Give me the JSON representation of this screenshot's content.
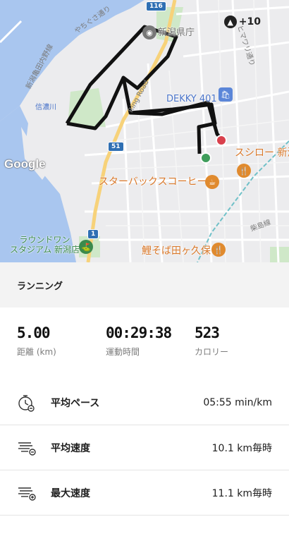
{
  "map": {
    "labels": {
      "prefecture_office": "新潟県庁",
      "dekky": "DEKKY 401",
      "sushiro": "スシロー 新潟",
      "starbucks": "スターバックスコーヒー",
      "koi": "鯉そば田ヶ久保",
      "stadium": "ラウンドワン\nスタジアム 新潟店",
      "yachigusa": "やちぐさ通り",
      "himawari": "ヒマワリ通り",
      "niigata_oyuta": "新潟亀田内野線",
      "shinano": "信濃川",
      "shiba": "柴島線",
      "ring": "Ring Road",
      "google": "Google"
    },
    "road_badges": {
      "r116": "116",
      "r51": "51",
      "r1": "1"
    },
    "weather": {
      "value": "+10"
    }
  },
  "activity_type": "ランニング",
  "stats": [
    {
      "value": "5.00",
      "label": "距離 (km)"
    },
    {
      "value": "00:29:38",
      "label": "運動時間"
    },
    {
      "value": "523",
      "label": "カロリー"
    }
  ],
  "metrics": [
    {
      "name": "平均ペース",
      "value": "05:55 min/km",
      "icon": "stopwatch-icon"
    },
    {
      "name": "平均速度",
      "value": "10.1 km毎時",
      "icon": "speed-average-icon"
    },
    {
      "name": "最大速度",
      "value": "11.1 km毎時",
      "icon": "speed-max-icon"
    }
  ],
  "colors": {
    "route": "#111111",
    "start": "#3f9d5b",
    "finish": "#d9414d",
    "river": "#a9c6ef",
    "park": "#cfe8c8",
    "accent_orange": "#d9782a"
  }
}
